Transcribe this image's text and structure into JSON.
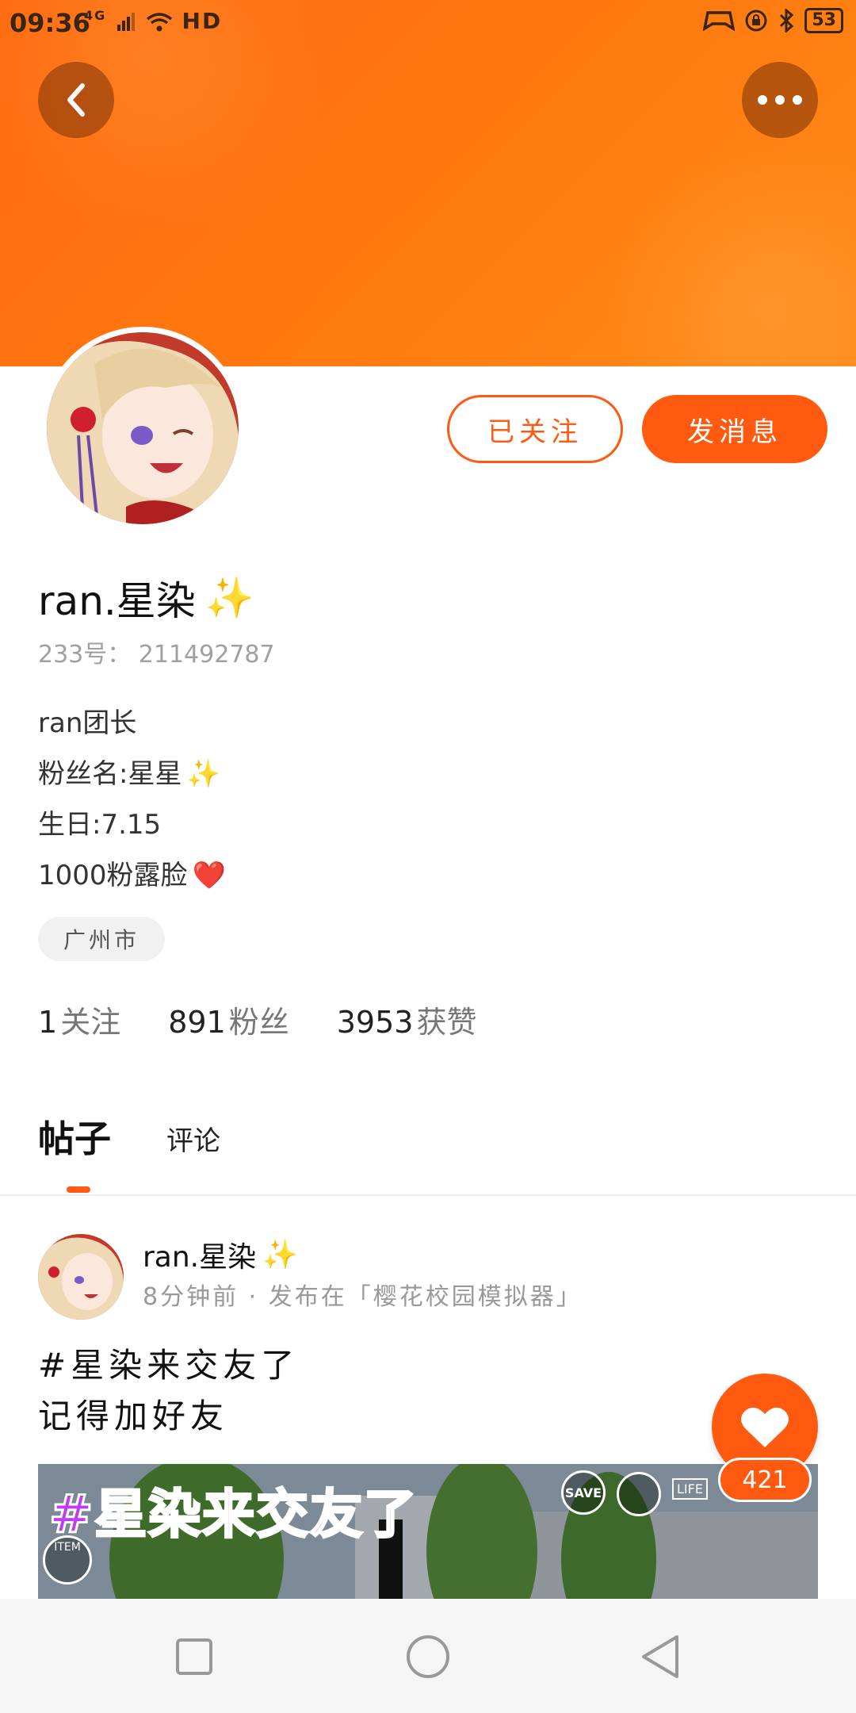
{
  "status_bar": {
    "time": "09:36",
    "signal_label": "4G",
    "hd_label": "HD",
    "battery": "53"
  },
  "header": {
    "back_icon": "chevron-left-icon",
    "more_icon": "more-dots-icon",
    "background_color": "#ff7a12"
  },
  "profile": {
    "follow_button_label": "已关注",
    "message_button_label": "发消息",
    "name": "ran.星染",
    "name_emoji": "✨",
    "uid": "233号： 211492787",
    "bio": [
      {
        "text": "ran团长",
        "emoji": ""
      },
      {
        "text": "粉丝名:星星",
        "emoji": "✨"
      },
      {
        "text": "生日:7.15",
        "emoji": ""
      },
      {
        "text": "1000粉露脸",
        "emoji": "❤️"
      }
    ],
    "location": "广州市",
    "stats": [
      {
        "num": "1",
        "label": "关注"
      },
      {
        "num": "891",
        "label": "粉丝"
      },
      {
        "num": "3953",
        "label": "获赞"
      }
    ]
  },
  "tabs": {
    "posts": "帖子",
    "comments": "评论"
  },
  "post": {
    "author": "ran.星染",
    "author_emoji": "✨",
    "meta": "8分钟前 · 发布在「樱花校园模拟器」",
    "text_line1": "#星染来交友了",
    "text_line2": "记得加好友",
    "image_title": "#星染来交友了",
    "image_save_label": "SAVE",
    "image_item_label": "ITEM",
    "image_life_label": "LIFE",
    "like_count": "421"
  },
  "accent_color": "#ff5a0f",
  "navbar": {
    "recent_icon": "square-icon",
    "home_icon": "circle-icon",
    "back_icon": "triangle-back-icon"
  }
}
